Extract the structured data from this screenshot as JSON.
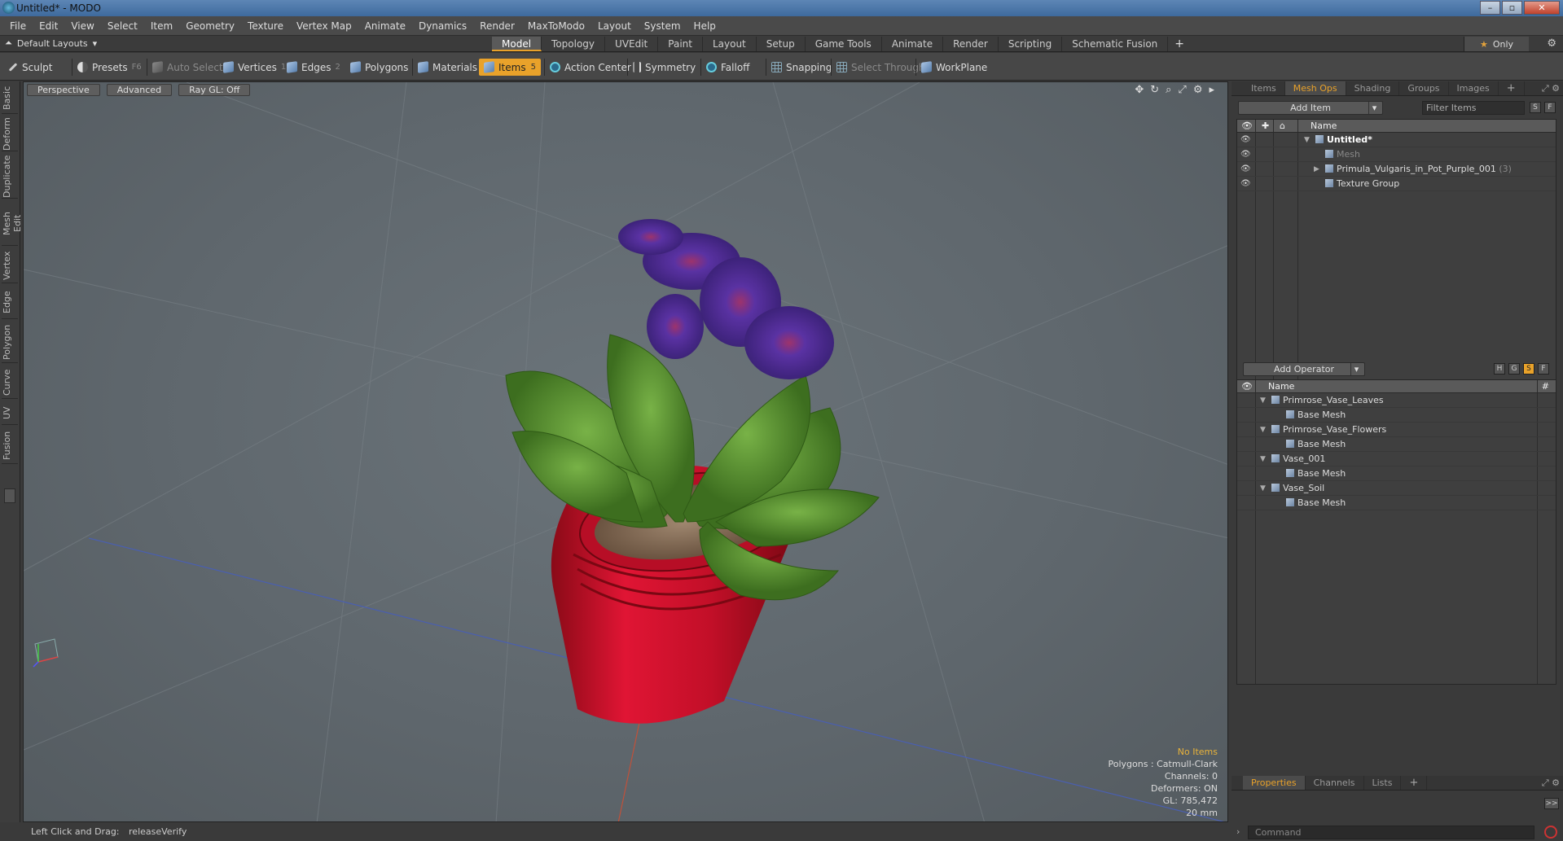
{
  "window": {
    "title": "Untitled* - MODO",
    "minimize": "–",
    "maximize": "▫",
    "close": "✕"
  },
  "menu": [
    "File",
    "Edit",
    "View",
    "Select",
    "Item",
    "Geometry",
    "Texture",
    "Vertex Map",
    "Animate",
    "Dynamics",
    "Render",
    "MaxToModo",
    "Layout",
    "System",
    "Help"
  ],
  "layout": {
    "selector": "Default Layouts",
    "tabs": [
      "Model",
      "Topology",
      "UVEdit",
      "Paint",
      "Layout",
      "Setup",
      "Game Tools",
      "Animate",
      "Render",
      "Scripting",
      "Schematic Fusion"
    ],
    "active_tab": "Model",
    "plus": "+",
    "only_label": "Only"
  },
  "toolbar": {
    "sculpt": "Sculpt",
    "presets": "Presets",
    "presets_key": "F6",
    "auto_select": "Auto Select",
    "vertices": "Vertices",
    "vertices_key": "1",
    "edges": "Edges",
    "edges_key": "2",
    "polygons": "Polygons",
    "materials": "Materials",
    "items": "Items",
    "items_key": "5",
    "action_center": "Action Center",
    "symmetry": "Symmetry",
    "falloff": "Falloff",
    "snapping": "Snapping",
    "select_through": "Select Through",
    "workplane": "WorkPlane"
  },
  "left_tabs": [
    "Basic",
    "Deform",
    "Duplicate",
    "Mesh Edit",
    "Vertex",
    "Edge",
    "Polygon",
    "Curve",
    "UV",
    "Fusion"
  ],
  "viewport": {
    "view": "Perspective",
    "shading": "Advanced",
    "raygl": "Ray GL: Off",
    "stats": {
      "selection": "No Items",
      "polygons": "Polygons : Catmull-Clark",
      "channels": "Channels: 0",
      "deformers": "Deformers: ON",
      "gl": "GL: 785,472",
      "scale": "20 mm"
    }
  },
  "items_panel": {
    "tabs": [
      "Items",
      "Mesh Ops",
      "Shading",
      "Groups",
      "Images"
    ],
    "active_tab": "Mesh Ops",
    "add_item": "Add Item",
    "filter_placeholder": "Filter Items",
    "s_btn": "S",
    "f_btn": "F",
    "col_name": "Name",
    "rows": [
      {
        "label": "Untitled*",
        "style": "bold"
      },
      {
        "label": "Mesh",
        "style": "dim"
      },
      {
        "label": "Primula_Vulgaris_in_Pot_Purple_001",
        "count": "(3)",
        "style": "normal"
      },
      {
        "label": "Texture Group",
        "style": "normal"
      }
    ]
  },
  "ops_panel": {
    "add_operator": "Add Operator",
    "h_btn": "H",
    "g_btn": "G",
    "s_btn": "S",
    "f_btn": "F",
    "col_name": "Name",
    "col_hash": "#",
    "rows": [
      {
        "label": "Primrose_Vase_Leaves",
        "level": 0
      },
      {
        "label": "Base Mesh",
        "level": 1
      },
      {
        "label": "Primrose_Vase_Flowers",
        "level": 0
      },
      {
        "label": "Base Mesh",
        "level": 1
      },
      {
        "label": "Vase_001",
        "level": 0
      },
      {
        "label": "Base Mesh",
        "level": 1
      },
      {
        "label": "Vase_Soil",
        "level": 0
      },
      {
        "label": "Base Mesh",
        "level": 1
      }
    ]
  },
  "props_panel": {
    "tabs": [
      "Properties",
      "Channels",
      "Lists"
    ],
    "active_tab": "Properties",
    "expand": ">>",
    "command_placeholder": "Command"
  },
  "status": {
    "hint": "Left Click and Drag:",
    "action": "releaseVerify"
  },
  "colors": {
    "accent": "#e9a22a",
    "pot": "#d0102a",
    "leaf": "#4f8a2c",
    "flower": "#5a2fa6"
  }
}
